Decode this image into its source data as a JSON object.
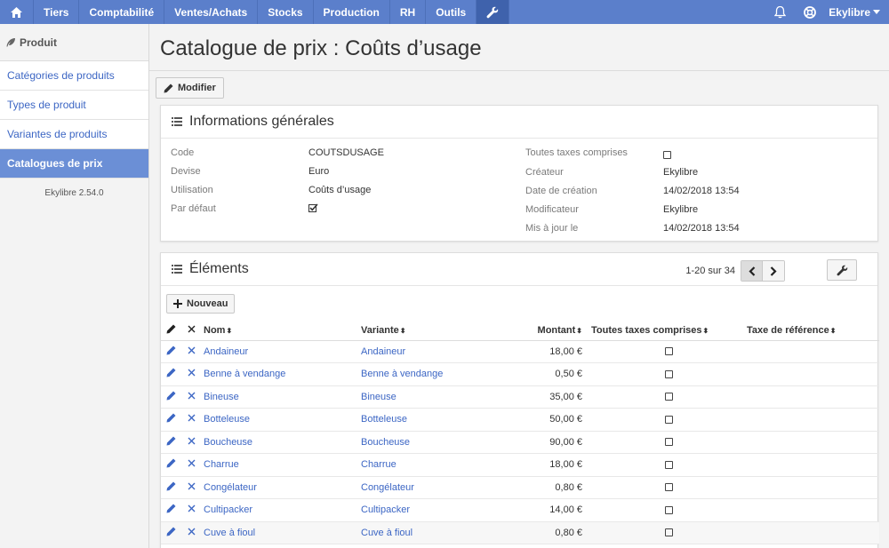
{
  "nav": {
    "items": [
      "Tiers",
      "Comptabilité",
      "Ventes/Achats",
      "Stocks",
      "Production",
      "RH",
      "Outils"
    ],
    "user": "Ekylibre"
  },
  "sidebar": {
    "title": "Produit",
    "items": [
      {
        "label": "Catégories de produits",
        "active": false
      },
      {
        "label": "Types de produit",
        "active": false
      },
      {
        "label": "Variantes de produits",
        "active": false
      },
      {
        "label": "Catalogues de prix",
        "active": true
      }
    ],
    "version": "Ekylibre 2.54.0"
  },
  "page": {
    "title": "Catalogue de prix : Coûts d’usage",
    "edit_label": "Modifier"
  },
  "info": {
    "title": "Informations générales",
    "left": [
      {
        "label": "Code",
        "value": "COUTSDUSAGE"
      },
      {
        "label": "Devise",
        "value": "Euro"
      },
      {
        "label": "Utilisation",
        "value": "Coûts d’usage"
      },
      {
        "label": "Par défaut",
        "value": "checked"
      }
    ],
    "right": [
      {
        "label": "Toutes taxes comprises",
        "value": "unchecked"
      },
      {
        "label": "Créateur",
        "value": "Ekylibre"
      },
      {
        "label": "Date de création",
        "value": "14/02/2018 13:54"
      },
      {
        "label": "Modificateur",
        "value": "Ekylibre"
      },
      {
        "label": "Mis à jour le",
        "value": "14/02/2018 13:54"
      }
    ]
  },
  "elements": {
    "title": "Éléments",
    "pagination": "1-20 sur 34",
    "new_label": "Nouveau",
    "columns": {
      "nom": "Nom",
      "variante": "Variante",
      "montant": "Montant",
      "ttc": "Toutes taxes comprises",
      "taxe": "Taxe de référence"
    },
    "rows": [
      {
        "nom": "Andaineur",
        "variante": "Andaineur",
        "montant": "18,00 €",
        "ttc": false,
        "taxe": ""
      },
      {
        "nom": "Benne à vendange",
        "variante": "Benne à vendange",
        "montant": "0,50 €",
        "ttc": false,
        "taxe": ""
      },
      {
        "nom": "Bineuse",
        "variante": "Bineuse",
        "montant": "35,00 €",
        "ttc": false,
        "taxe": ""
      },
      {
        "nom": "Botteleuse",
        "variante": "Botteleuse",
        "montant": "50,00 €",
        "ttc": false,
        "taxe": ""
      },
      {
        "nom": "Boucheuse",
        "variante": "Boucheuse",
        "montant": "90,00 €",
        "ttc": false,
        "taxe": ""
      },
      {
        "nom": "Charrue",
        "variante": "Charrue",
        "montant": "18,00 €",
        "ttc": false,
        "taxe": ""
      },
      {
        "nom": "Congélateur",
        "variante": "Congélateur",
        "montant": "0,80 €",
        "ttc": false,
        "taxe": ""
      },
      {
        "nom": "Cultipacker",
        "variante": "Cultipacker",
        "montant": "14,00 €",
        "ttc": false,
        "taxe": ""
      },
      {
        "nom": "Cuve à fioul",
        "variante": "Cuve à fioul",
        "montant": "0,80 €",
        "ttc": false,
        "taxe": ""
      }
    ]
  },
  "colors": {
    "nav": "#5b7fcb",
    "nav_active": "#3f62ac",
    "link": "#3c66c4",
    "sidebar_active": "#6b8fd6"
  }
}
